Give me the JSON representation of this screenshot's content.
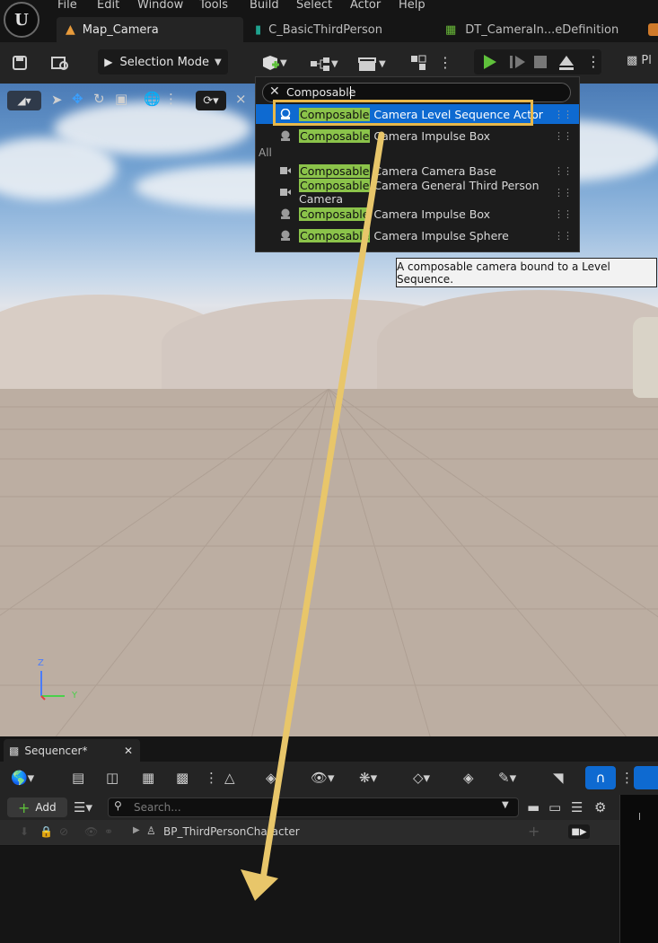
{
  "menu": [
    "File",
    "Edit",
    "Window",
    "Tools",
    "Build",
    "Select",
    "Actor",
    "Help"
  ],
  "logo_text": "U",
  "tabs": [
    {
      "label": "Map_Camera"
    },
    {
      "label": "C_BasicThirdPerson"
    },
    {
      "label": "DT_CameraIn...eDefinition"
    }
  ],
  "toolbar": {
    "selection_mode": "Selection Mode",
    "platform_partial": "Pl"
  },
  "search": {
    "value": "Composable"
  },
  "dropdown": {
    "results": [
      {
        "match": "Composable",
        "rest": " Camera Level Sequence Actor",
        "selected": true,
        "icon": "camera-actor-icon"
      },
      {
        "match": "Composable",
        "rest": " Camera Impulse Box",
        "selected": false,
        "icon": "impulse-icon"
      }
    ],
    "section_label": "All",
    "all_results": [
      {
        "match": "Composable",
        "rest": " Camera Camera Base",
        "icon": "video-camera-icon"
      },
      {
        "match": "Composable",
        "rest": " Camera General Third Person Camera",
        "icon": "video-camera-icon"
      },
      {
        "match": "Composable",
        "rest": " Camera Impulse Box",
        "icon": "impulse-icon"
      },
      {
        "match": "Composable",
        "rest": " Camera Impulse Sphere",
        "icon": "impulse-icon"
      }
    ]
  },
  "tooltip": "A composable camera bound to a Level Sequence.",
  "axis": {
    "z": "Z",
    "y": "Y"
  },
  "sequencer": {
    "tab_label": "Sequencer*",
    "add_label": "Add",
    "search_placeholder": "Search...",
    "track_label": "BP_ThirdPersonCharacter"
  },
  "colors": {
    "accent": "#0e6ad1",
    "highlight": "#8bc34a",
    "annotation": "#e8c66a",
    "play": "#5fc13b"
  }
}
